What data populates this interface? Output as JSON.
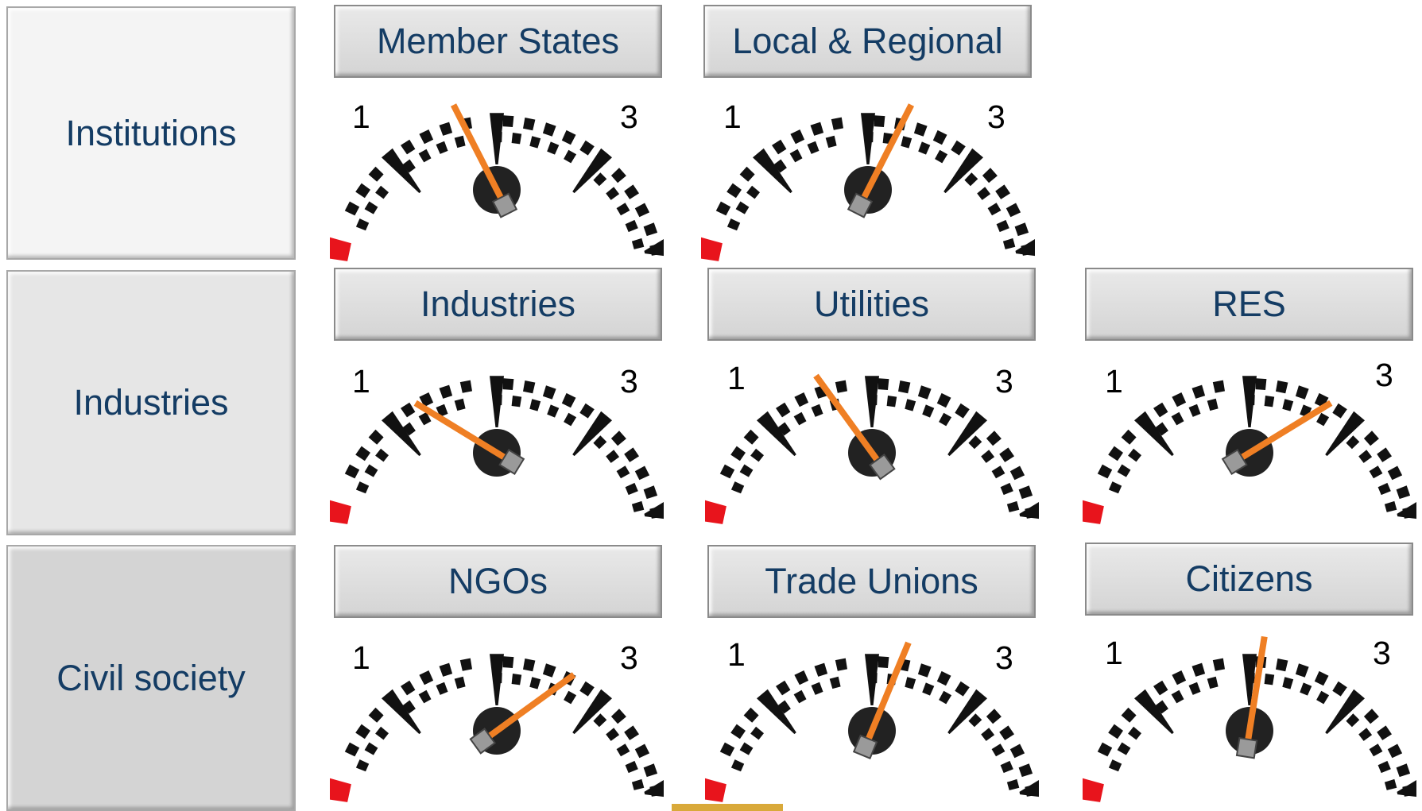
{
  "rows": [
    {
      "label": "Institutions"
    },
    {
      "label": "Industries"
    },
    {
      "label": "Civil society"
    }
  ],
  "scale": {
    "min": "1",
    "max": "3"
  },
  "gauges": [
    {
      "label": "Member States",
      "value": 1.7
    },
    {
      "label": "Local & Regional",
      "value": 2.3
    },
    {
      "label": "Industries",
      "value": 1.35
    },
    {
      "label": "Utilities",
      "value": 1.6
    },
    {
      "label": "RES",
      "value": 2.65
    },
    {
      "label": "NGOs",
      "value": 2.6
    },
    {
      "label": "Trade Unions",
      "value": 2.25
    },
    {
      "label": "Citizens",
      "value": 2.1
    }
  ],
  "colors": {
    "label_text": "#143c64",
    "needle": "#ef7f24",
    "low_zone": "#e8141c",
    "tick": "#111111"
  }
}
